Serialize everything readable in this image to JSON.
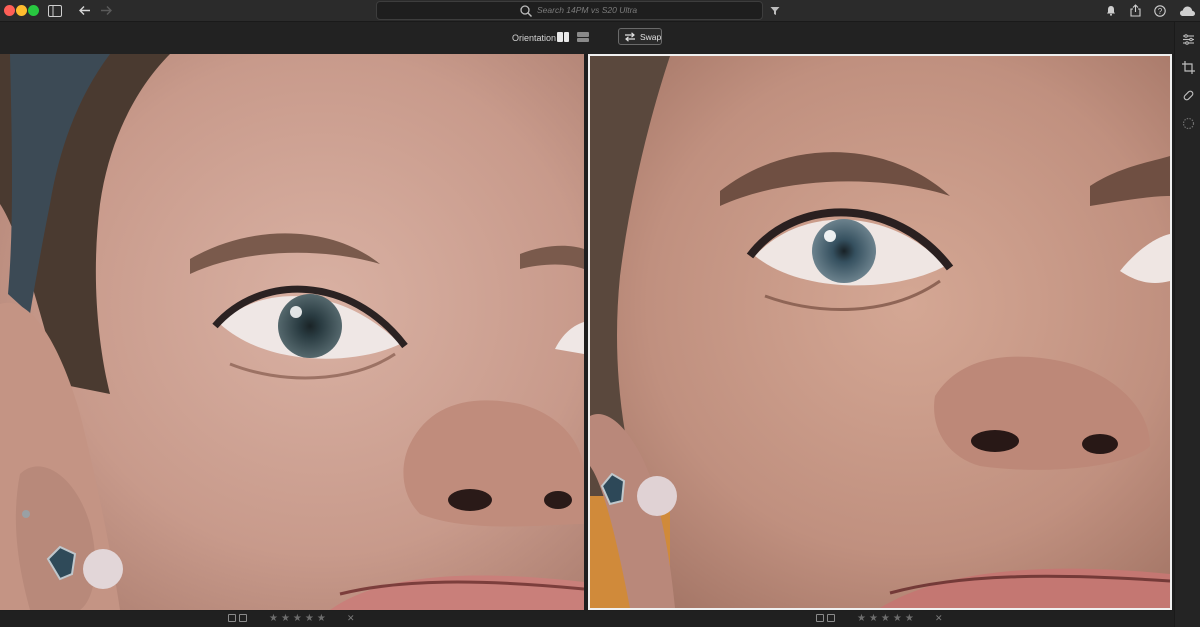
{
  "window": {
    "title": ""
  },
  "search": {
    "placeholder": "Search 14PM vs S20 Ultra"
  },
  "toolbar": {
    "orientation_label": "Orientation",
    "swap_label": "Swap"
  },
  "left_photo": {
    "rating_stars": "★★★★★",
    "reject_label": "✕"
  },
  "right_photo": {
    "rating_stars": "★★★★★",
    "reject_label": "✕"
  },
  "colors": {
    "accent_border": "#f0f0f0",
    "chrome_dark": "#1e1e1e"
  },
  "icons": [
    "sidebar-toggle-icon",
    "back-arrow-icon",
    "forward-arrow-icon",
    "search-icon",
    "filter-icon",
    "bell-icon",
    "share-icon",
    "help-icon",
    "cloud-sync-icon",
    "edit-sliders-icon",
    "crop-icon",
    "healing-bandage-icon",
    "masking-icon"
  ]
}
